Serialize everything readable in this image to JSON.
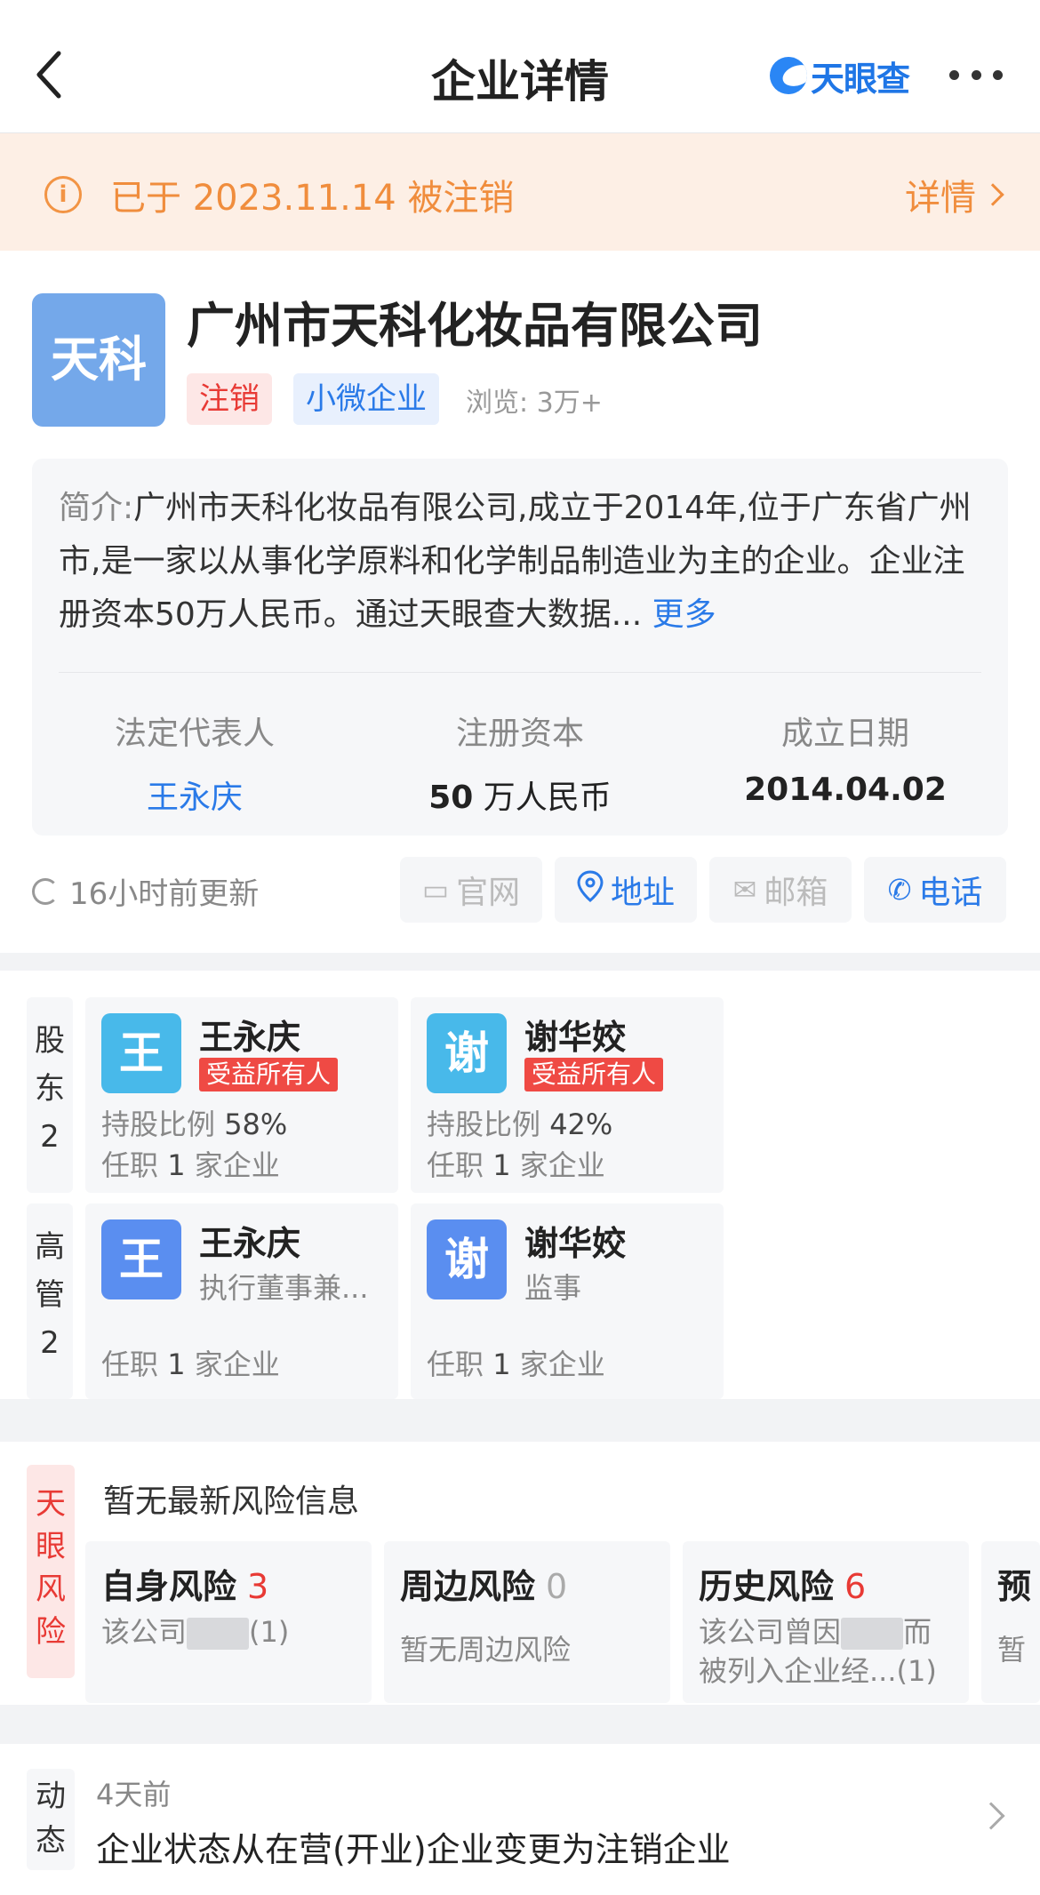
{
  "header": {
    "title": "企业详情",
    "logo_text": "天眼查"
  },
  "banner": {
    "text": "已于 2023.11.14 被注销",
    "link": "详情"
  },
  "company": {
    "avatar_text": "天科",
    "name": "广州市天科化妆品有限公司",
    "tags": [
      "注销",
      "小微企业"
    ],
    "views_label": "浏览:",
    "views_value": "3万+",
    "intro_label": "简介:",
    "intro_text": "广州市天科化妆品有限公司,成立于2014年,位于广东省广州市,是一家以从事化学原料和化学制品制造业为主的企业。企业注册资本50万人民币。通过天眼查大数据...",
    "intro_more": "更多",
    "legal_rep_label": "法定代表人",
    "legal_rep_value": "王永庆",
    "capital_label": "注册资本",
    "capital_num": "50",
    "capital_unit": "万人民币",
    "founded_label": "成立日期",
    "founded_value": "2014.04.02",
    "updated": "16小时前更新",
    "actions": {
      "website": "官网",
      "address": "地址",
      "email": "邮箱",
      "phone": "电话"
    }
  },
  "shareholders": {
    "label_chars": [
      "股",
      "东"
    ],
    "count": "2",
    "items": [
      {
        "avatar": "王",
        "name": "王永庆",
        "badge": "受益所有人",
        "ratio_label": "持股比例",
        "ratio": "58%",
        "job_prefix": "任职",
        "job_count": "1",
        "job_suffix": "家企业"
      },
      {
        "avatar": "谢",
        "name": "谢华姣",
        "badge": "受益所有人",
        "ratio_label": "持股比例",
        "ratio": "42%",
        "job_prefix": "任职",
        "job_count": "1",
        "job_suffix": "家企业"
      }
    ]
  },
  "executives": {
    "label_chars": [
      "高",
      "管"
    ],
    "count": "2",
    "items": [
      {
        "avatar": "王",
        "name": "王永庆",
        "role": "执行董事兼...",
        "job_prefix": "任职",
        "job_count": "1",
        "job_suffix": "家企业"
      },
      {
        "avatar": "谢",
        "name": "谢华姣",
        "role": "监事",
        "job_prefix": "任职",
        "job_count": "1",
        "job_suffix": "家企业"
      }
    ]
  },
  "risk": {
    "label_chars": [
      "天",
      "眼",
      "风",
      "险"
    ],
    "headline": "暂无最新风险信息",
    "cards": [
      {
        "title": "自身风险",
        "count": "3",
        "desc_pre": "该公司",
        "desc_post": "(1)"
      },
      {
        "title": "周边风险",
        "count": "0",
        "desc": "暂无周边风险"
      },
      {
        "title": "历史风险",
        "count": "6",
        "desc_pre": "该公司曾因",
        "desc_post": "而被列入企业经...(1)"
      },
      {
        "title": "预",
        "desc": "暂"
      }
    ]
  },
  "news": {
    "label_chars": [
      "动",
      "态"
    ],
    "time": "4天前",
    "text": "企业状态从在营(开业)企业变更为注销企业"
  }
}
